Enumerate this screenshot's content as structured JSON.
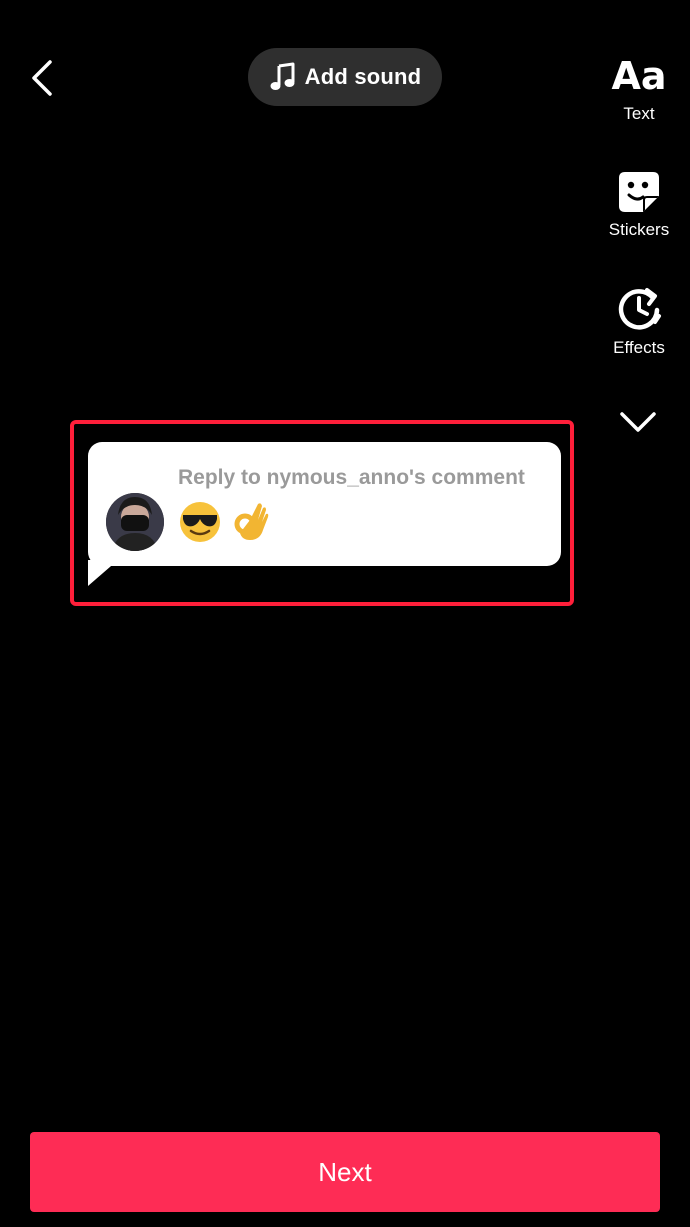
{
  "top_bar": {
    "back_icon": "chevron-left-icon",
    "add_sound": {
      "icon": "music-note-icon",
      "label": "Add sound"
    }
  },
  "side_tools": [
    {
      "id": "text",
      "icon": "text-aa-icon",
      "glyph": "Aa",
      "label": "Text"
    },
    {
      "id": "stickers",
      "icon": "sticker-icon",
      "label": "Stickers"
    },
    {
      "id": "effects",
      "icon": "effects-clock-icon",
      "label": "Effects"
    }
  ],
  "more_tools_icon": "chevron-down-icon",
  "reply_sticker": {
    "title": "Reply to nymous_anno's comment",
    "avatar": "avatar",
    "emojis": [
      "sunglasses-face-emoji",
      "ok-hand-emoji"
    ],
    "highlight_color": "#ff1f3a"
  },
  "next_button": {
    "label": "Next",
    "color": "#fe2c55"
  }
}
